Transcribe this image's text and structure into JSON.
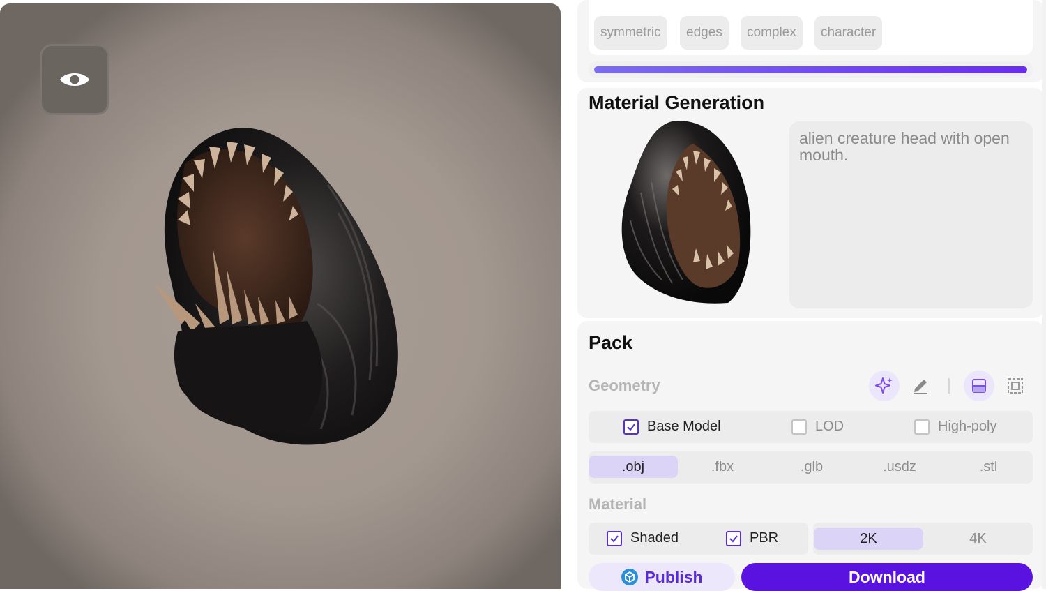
{
  "viewport": {
    "visibility_icon": "eye-icon"
  },
  "tags": [
    "symmetric",
    "edges",
    "complex",
    "character"
  ],
  "progress": {
    "fraction": 1.0,
    "color_start": "#7b6cf0",
    "color_end": "#6a2cf0"
  },
  "material_generation": {
    "title": "Material Generation",
    "prompt": "alien creature head with open mouth."
  },
  "pack": {
    "title": "Pack",
    "geometry": {
      "label": "Geometry",
      "tools": [
        "sparkle-icon",
        "pencil-icon",
        "uv-layout-icon",
        "bounding-box-icon"
      ],
      "options": [
        {
          "label": "Base Model",
          "checked": true
        },
        {
          "label": "LOD",
          "checked": false
        },
        {
          "label": "High-poly",
          "checked": false
        }
      ],
      "formats": [
        ".obj",
        ".fbx",
        ".glb",
        ".usdz",
        ".stl"
      ],
      "selected_format": ".obj"
    },
    "material": {
      "label": "Material",
      "options": [
        {
          "label": "Shaded",
          "checked": true
        },
        {
          "label": "PBR",
          "checked": true
        }
      ],
      "resolutions": [
        "2K",
        "4K"
      ],
      "selected_resolution": "2K"
    },
    "publish_label": "Publish",
    "download_label": "Download"
  },
  "colors": {
    "accent": "#5a12e0",
    "accent_light": "#dcd4f6"
  }
}
